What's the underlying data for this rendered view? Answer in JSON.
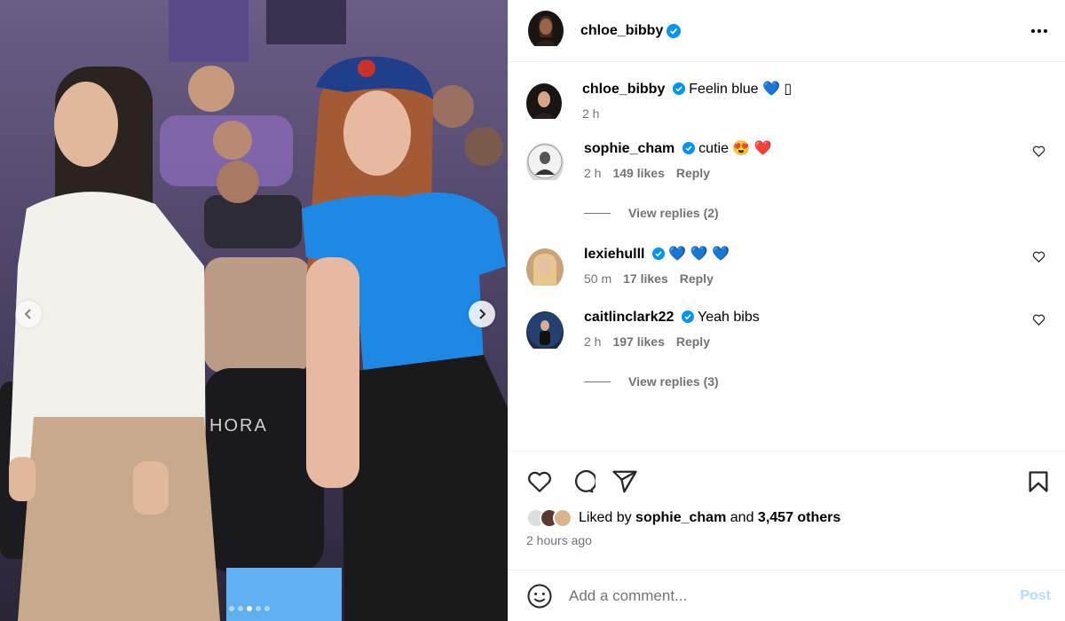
{
  "post": {
    "username": "chloe_bibby",
    "caption": "Feelin blue 💙 ",
    "caption_extra": "▯",
    "caption_time": "2 h"
  },
  "comments": [
    {
      "username": "sophie_cham",
      "text": "cutie 😍 ❤️",
      "time": "2 h",
      "likes": "149 likes",
      "reply": "Reply",
      "view_replies": "View replies (2)"
    },
    {
      "username": "lexiehulll",
      "text": "💙 💙 💙",
      "time": "50 m",
      "likes": "17 likes",
      "reply": "Reply"
    },
    {
      "username": "caitlinclark22",
      "text": "Yeah bibs",
      "time": "2 h",
      "likes": "197 likes",
      "reply": "Reply",
      "view_replies": "View replies (3)"
    }
  ],
  "liked_by": {
    "prefix": "Liked by",
    "user": "sophie_cham",
    "and": "and",
    "others": "3,457 others"
  },
  "posted_ago": "2 hours ago",
  "add_comment": {
    "placeholder": "Add a comment...",
    "post_label": "Post"
  },
  "media": {
    "carousel_count": 5,
    "active_index": 2,
    "scene_text": "HORA"
  },
  "colors": {
    "verified": "#0095f6",
    "post_button": "#b3dbff",
    "muted": "#737373"
  },
  "icons": [
    "more-options-icon",
    "verified-icon",
    "heart-icon",
    "comment-icon",
    "share-icon",
    "bookmark-icon",
    "smile-icon",
    "chevron-left-icon",
    "chevron-right-icon"
  ]
}
